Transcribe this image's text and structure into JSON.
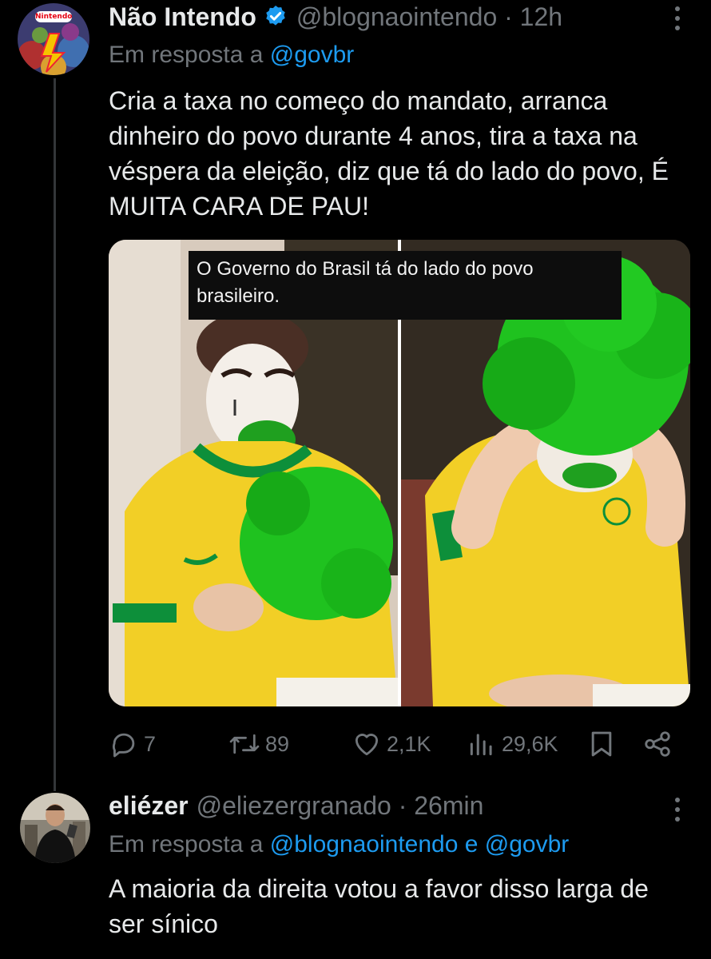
{
  "tweet": {
    "display_name": "Não Intendo",
    "handle_time": "@blognaointendo · 12h",
    "reply_prefix": "Em resposta a",
    "reply_handle": "@govbr",
    "text": "Cria a taxa no começo do mandato, arranca dinheiro do povo durante 4 anos, tira a taxa na véspera da eleição, diz que tá do lado do povo, É MUITA CARA DE PAU!",
    "image_caption": "O Governo do Brasil tá do lado do povo brasileiro.",
    "avatar_label": "Nintendo",
    "stats": {
      "replies": "7",
      "retweets": "89",
      "likes": "2,1K",
      "views": "29,6K"
    }
  },
  "reply": {
    "display_name": "eliézer",
    "handle_time": "@eliezergranado · 26min",
    "reply_prefix": "Em resposta a",
    "reply_handles": "@blognaointendo e @govbr",
    "text": "A maioria da direita votou a favor disso larga de ser sínico"
  },
  "icons": {
    "verified": "verified-badge-icon",
    "more": "more-icon",
    "reply": "reply-icon",
    "retweet": "retweet-icon",
    "like": "heart-icon",
    "views": "views-icon",
    "bookmark": "bookmark-icon",
    "share": "share-icon"
  },
  "colors": {
    "background": "#000000",
    "text": "#e7e9ea",
    "secondary": "#71767b",
    "link": "#1d9bf0",
    "jersey_yellow": "#f2cf26",
    "wig_green": "#1fc21f"
  }
}
